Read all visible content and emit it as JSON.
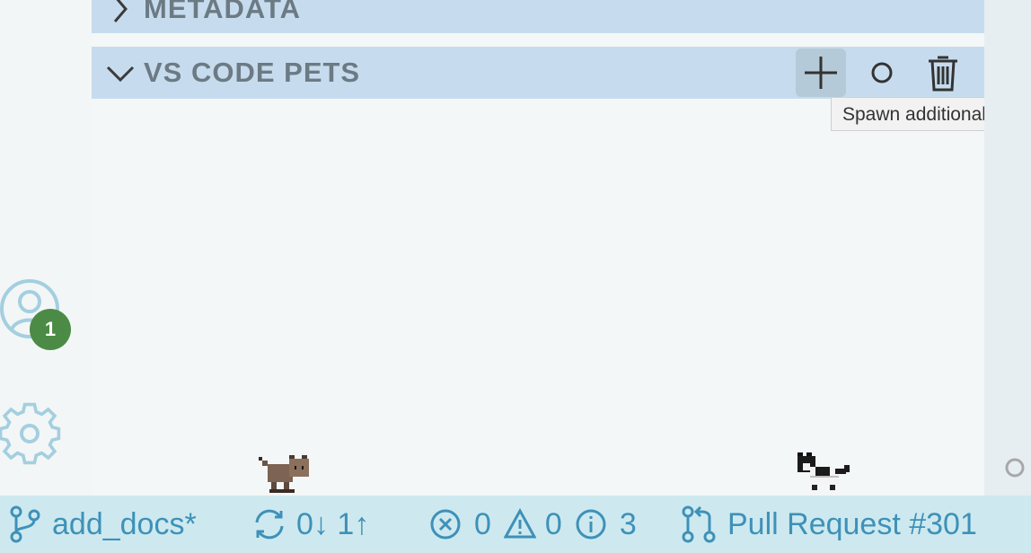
{
  "sections": {
    "metadata": {
      "title": "METADATA"
    },
    "pets": {
      "title": "VS CODE PETS"
    }
  },
  "tooltip": {
    "text": "Spawn additional pet"
  },
  "account": {
    "badge_count": "1"
  },
  "status_bar": {
    "branch": "add_docs*",
    "sync": "0↓ 1↑",
    "errors": "0",
    "warnings": "0",
    "info": "3",
    "pull_request": "Pull Request #301"
  },
  "colors": {
    "section_header_bg": "#c6dcee",
    "status_bar_bg": "#cde9ef",
    "status_text": "#3e91b8",
    "badge_bg": "#4c8b45"
  },
  "pets": [
    {
      "name": "brown-cat"
    },
    {
      "name": "black-white-cat"
    }
  ]
}
